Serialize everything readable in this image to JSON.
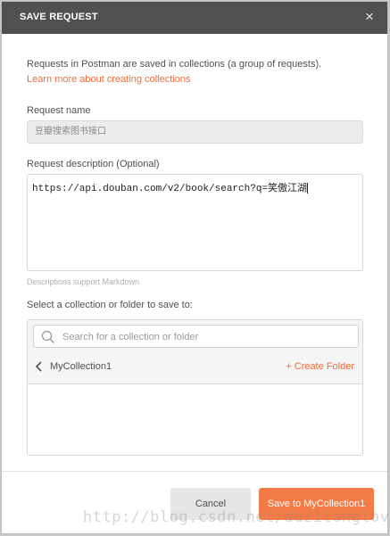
{
  "modal": {
    "title": "SAVE REQUEST",
    "close_glyph": "×",
    "intro_text": "Requests in Postman are saved in collections (a group of requests).",
    "learn_link": "Learn more about creating collections"
  },
  "request_name": {
    "label": "Request name",
    "value": "豆瓣搜索图书接口"
  },
  "request_description": {
    "label": "Request description (Optional)",
    "value": "https://api.douban.com/v2/book/search?q=笑傲江湖",
    "hint": "Descriptions support Markdown"
  },
  "collection": {
    "label": "Select a collection or folder to save to:",
    "search_placeholder": "Search for a collection or folder",
    "current": "MyCollection1",
    "create_folder": "+ Create Folder"
  },
  "footer": {
    "cancel_label": "Cancel",
    "save_label": "Save to MyCollection1"
  },
  "watermark": "http://blog.csdn.net/duzilonglove",
  "colors": {
    "accent": "#f26b3a",
    "header_bg": "#505050",
    "save_button": "#f47a46"
  },
  "icons": {
    "close": "close-icon",
    "search": "search-icon",
    "back": "chevron-left-icon"
  }
}
